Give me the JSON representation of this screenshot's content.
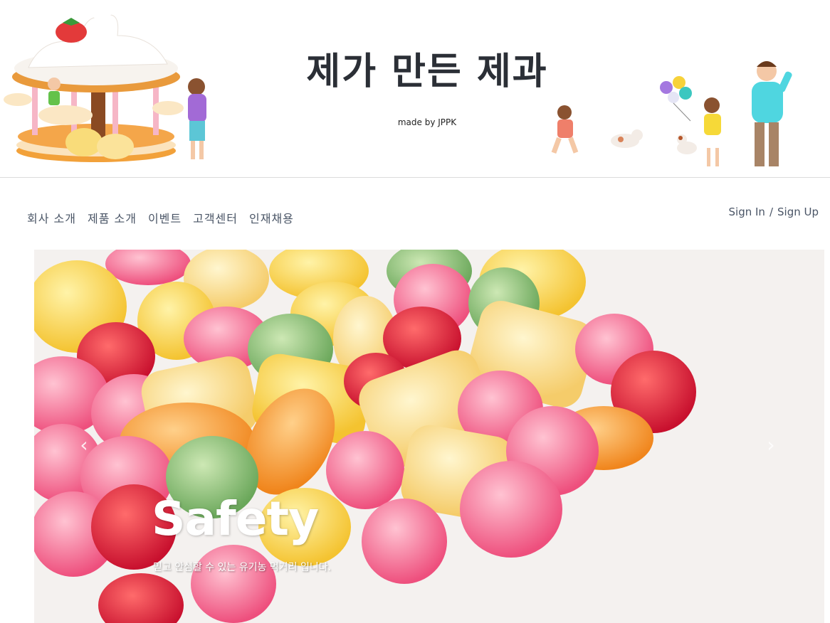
{
  "header": {
    "title": "제가 만든 제과",
    "subtitle": "made by JPPK"
  },
  "nav": {
    "items": [
      "회사 소개",
      "제품 소개",
      "이벤트",
      "고객센터",
      "인재채용"
    ]
  },
  "auth": {
    "sign_in": "Sign In",
    "separator": "/",
    "sign_up": "Sign Up"
  },
  "carousel": {
    "slide_title": "Safety",
    "slide_description": "믿고 안심할 수 있는 유기농 먹거리 입니다.",
    "prev_icon": "chevron-left-icon",
    "next_icon": "chevron-right-icon"
  }
}
